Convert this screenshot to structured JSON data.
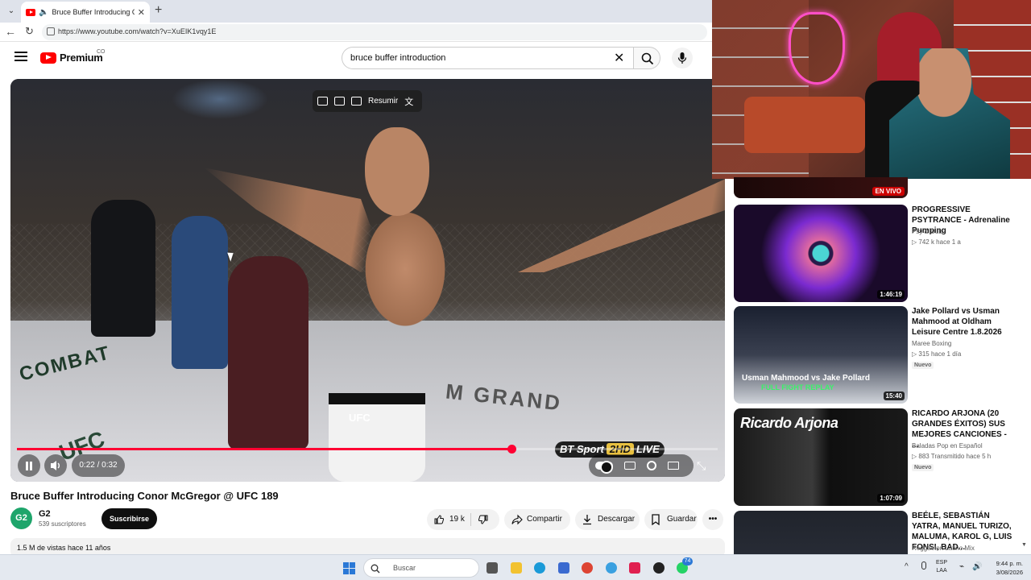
{
  "browser": {
    "tab_title": "Bruce Buffer Introducing Conor McGregor",
    "url": "https://www.youtube.com/watch?v=XuEIK1vqy1E"
  },
  "header": {
    "logo_text": "Premium",
    "region": "CO",
    "search_value": "bruce buffer introduction"
  },
  "player": {
    "summary_label": "Resumir",
    "time": "0:22 / 0:32",
    "progress_fraction": 0.706,
    "overlay_brand": "BT Sport",
    "overlay_hd": "2HD",
    "overlay_live": "LIVE"
  },
  "video": {
    "title": "Bruce Buffer Introducing Conor McGregor @ UFC 189",
    "channel_initials": "G2",
    "channel_name": "G2",
    "subscribers": "539 suscriptores",
    "subscribe_label": "Suscribirse",
    "likes": "19 k",
    "share_label": "Compartir",
    "download_label": "Descargar",
    "save_label": "Guardar",
    "more_label": "•••",
    "views_line": "1.5 M de vistas  hace 11 años"
  },
  "recommendations": [
    {
      "live_label": "EN VIVO"
    },
    {
      "title": "PROGRESSIVE PSYTRANCE - Adrenaline Pumping",
      "channel": "Psy & Dub",
      "meta": "▷ 742 k   hace 1 a",
      "duration": "1:46:19"
    },
    {
      "title": "Jake Pollard vs Usman Mahmood at Oldham Leisure Centre 1.8.2026",
      "channel": "Maree Boxing",
      "meta": "▷ 315   hace 1 día",
      "badge": "Nuevo",
      "duration": "15:40",
      "thumb_text": "Usman Mahmood vs Jake Pollard",
      "thumb_sub": "FULL FIGHT REPLAY"
    },
    {
      "title": "RICARDO ARJONA (20 GRANDES ÉXITOS) SUS MEJORES CANCIONES - ...",
      "channel": "Baladas Pop en Español",
      "meta": "▷ 883   Transmitido hace 5 h",
      "badge": "Nuevo",
      "duration": "1:07:09",
      "thumb_text": "Ricardo Arjona"
    },
    {
      "title": "BEÉLE, SEBASTIÁN YATRA, MANUEL TURIZO, MALUMA, KAROL G,  LUIS FONSI, BAD...",
      "channel": "Reggaeton Latino Mix"
    }
  ],
  "taskbar": {
    "search_placeholder": "Buscar",
    "badge_count": "74",
    "lang_line1": "ESP",
    "lang_line2": "LAA",
    "time": "9:44 p. m.",
    "date": "3/08/2026"
  },
  "colors": {
    "yt_red": "#ff0000",
    "progress": "#ff0033",
    "subscribe_bg": "#0f0f0f"
  }
}
